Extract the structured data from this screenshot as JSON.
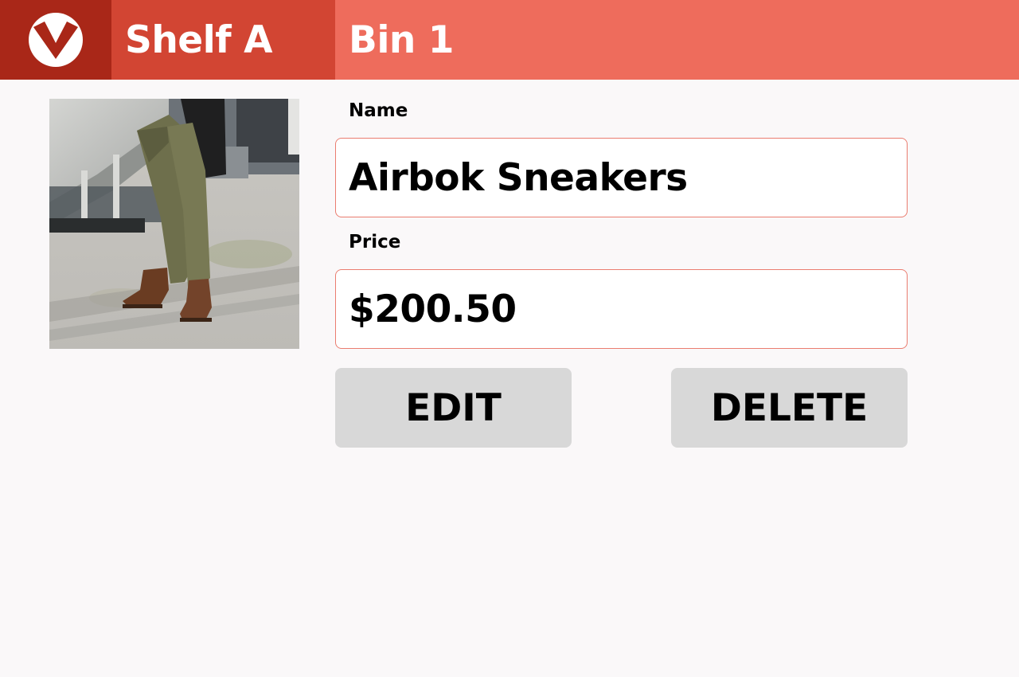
{
  "header": {
    "logo_icon": "chevron-down-badge-icon",
    "breadcrumb": {
      "shelf": "Shelf A",
      "bin": "Bin 1"
    }
  },
  "product": {
    "photo_icon": "product-photo",
    "name_label": "Name",
    "name_value": "Airbok Sneakers",
    "price_label": "Price",
    "price_value": "$200.50"
  },
  "actions": {
    "edit_label": "EDIT",
    "delete_label": "DELETE"
  },
  "colors": {
    "logo_bg": "#a92718",
    "shelf_bg": "#d24533",
    "bin_bg": "#ee6c5c",
    "field_border": "#ea7d70",
    "button_bg": "#d8d8d8",
    "page_bg": "#faf8f9"
  }
}
